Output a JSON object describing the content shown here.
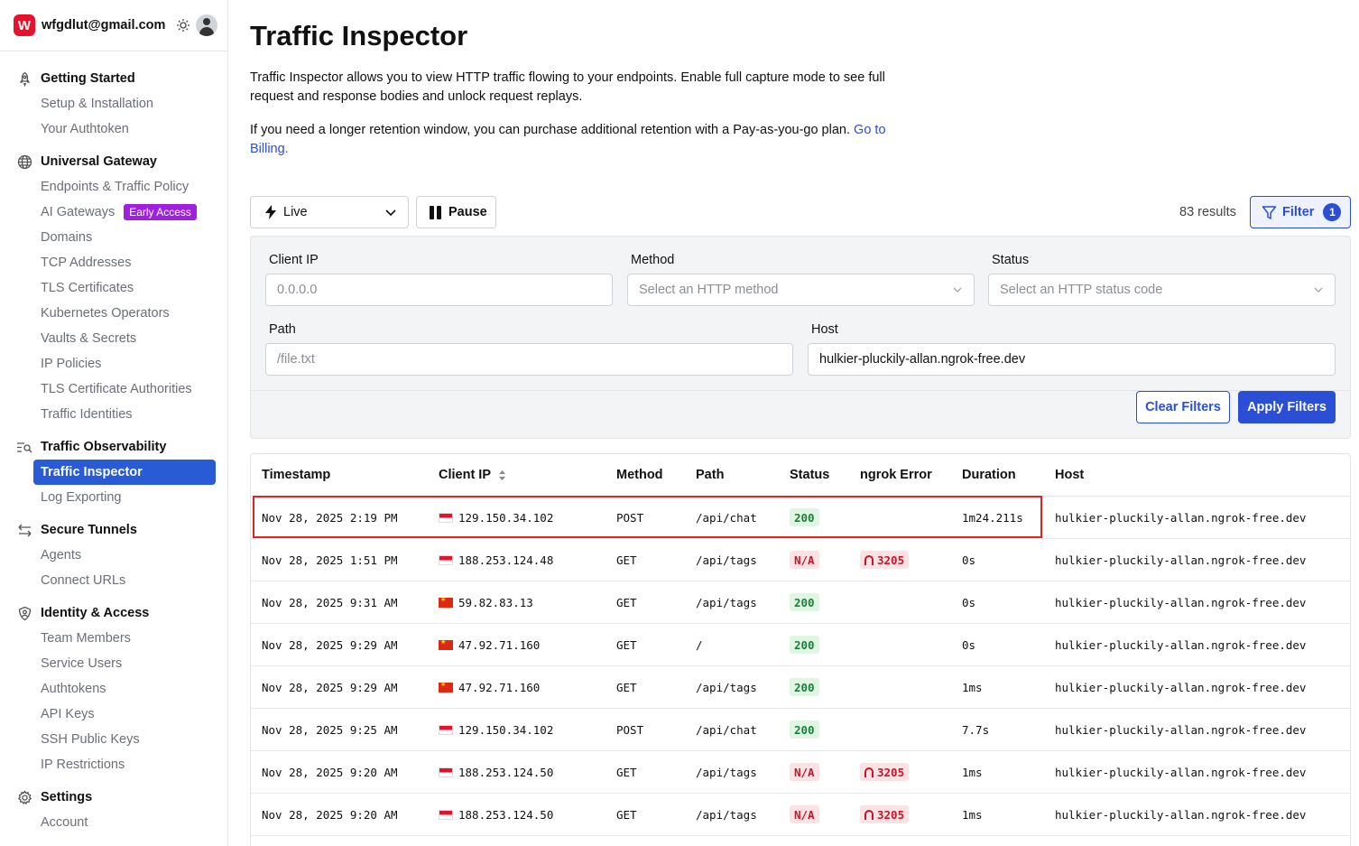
{
  "account": {
    "logo_letter": "W",
    "email": "wfgdlut@gmail.com"
  },
  "sidebar": {
    "groups": [
      {
        "title": "Getting Started",
        "icon": "rocket-icon",
        "items": [
          "Setup & Installation",
          "Your Authtoken"
        ]
      },
      {
        "title": "Universal Gateway",
        "icon": "globe-icon",
        "items": [
          "Endpoints & Traffic Policy",
          "AI Gateways",
          "Domains",
          "TCP Addresses",
          "TLS Certificates",
          "Kubernetes Operators",
          "Vaults & Secrets",
          "IP Policies",
          "TLS Certificate Authorities",
          "Traffic Identities"
        ]
      },
      {
        "title": "Traffic Observability",
        "icon": "list-search-icon",
        "items": [
          "Traffic Inspector",
          "Log Exporting"
        ]
      },
      {
        "title": "Secure Tunnels",
        "icon": "arrows-icon",
        "items": [
          "Agents",
          "Connect URLs"
        ]
      },
      {
        "title": "Identity & Access",
        "icon": "shield-icon",
        "items": [
          "Team Members",
          "Service Users",
          "Authtokens",
          "API Keys",
          "SSH Public Keys",
          "IP Restrictions"
        ]
      },
      {
        "title": "Settings",
        "icon": "gear-icon",
        "items": [
          "Account"
        ]
      }
    ],
    "early_access_badge": "Early Access"
  },
  "page": {
    "title": "Traffic Inspector",
    "intro1": "Traffic Inspector allows you to view HTTP traffic flowing to your endpoints. Enable full capture mode to see full request and response bodies and unlock request replays.",
    "intro2": "If you need a longer retention window, you can purchase additional retention with a Pay-as-you-go plan.",
    "billing_link": "Go to Billing."
  },
  "toolbar": {
    "mode": "Live",
    "pause_label": "Pause",
    "results": "83 results",
    "filter_label": "Filter",
    "filter_count": "1"
  },
  "filters": {
    "client_ip_label": "Client IP",
    "client_ip_placeholder": "0.0.0.0",
    "method_label": "Method",
    "method_placeholder": "Select an HTTP method",
    "status_label": "Status",
    "status_placeholder": "Select an HTTP status code",
    "path_label": "Path",
    "path_placeholder": "/file.txt",
    "host_label": "Host",
    "host_value": "hulkier-pluckily-allan.ngrok-free.dev",
    "clear_label": "Clear Filters",
    "apply_label": "Apply Filters"
  },
  "table": {
    "headers": {
      "timestamp": "Timestamp",
      "client_ip": "Client IP",
      "method": "Method",
      "path": "Path",
      "status": "Status",
      "error": "ngrok Error",
      "duration": "Duration",
      "host": "Host"
    },
    "rows": [
      {
        "timestamp": "Nov 28, 2025 2:19 PM",
        "flag": "sg",
        "ip": "129.150.34.102",
        "method": "POST",
        "path": "/api/chat",
        "status": "200",
        "status_kind": "ok",
        "error": "",
        "duration": "1m24.211s",
        "host": "hulkier-pluckily-allan.ngrok-free.dev"
      },
      {
        "timestamp": "Nov 28, 2025 1:51 PM",
        "flag": "sg",
        "ip": "188.253.124.48",
        "method": "GET",
        "path": "/api/tags",
        "status": "N/A",
        "status_kind": "na",
        "error": "3205",
        "duration": "0s",
        "host": "hulkier-pluckily-allan.ngrok-free.dev"
      },
      {
        "timestamp": "Nov 28, 2025 9:31 AM",
        "flag": "cn",
        "ip": "59.82.83.13",
        "method": "GET",
        "path": "/api/tags",
        "status": "200",
        "status_kind": "ok",
        "error": "",
        "duration": "0s",
        "host": "hulkier-pluckily-allan.ngrok-free.dev"
      },
      {
        "timestamp": "Nov 28, 2025 9:29 AM",
        "flag": "cn",
        "ip": "47.92.71.160",
        "method": "GET",
        "path": "/",
        "status": "200",
        "status_kind": "ok",
        "error": "",
        "duration": "0s",
        "host": "hulkier-pluckily-allan.ngrok-free.dev"
      },
      {
        "timestamp": "Nov 28, 2025 9:29 AM",
        "flag": "cn",
        "ip": "47.92.71.160",
        "method": "GET",
        "path": "/api/tags",
        "status": "200",
        "status_kind": "ok",
        "error": "",
        "duration": "1ms",
        "host": "hulkier-pluckily-allan.ngrok-free.dev"
      },
      {
        "timestamp": "Nov 28, 2025 9:25 AM",
        "flag": "sg",
        "ip": "129.150.34.102",
        "method": "POST",
        "path": "/api/chat",
        "status": "200",
        "status_kind": "ok",
        "error": "",
        "duration": "7.7s",
        "host": "hulkier-pluckily-allan.ngrok-free.dev"
      },
      {
        "timestamp": "Nov 28, 2025 9:20 AM",
        "flag": "sg",
        "ip": "188.253.124.50",
        "method": "GET",
        "path": "/api/tags",
        "status": "N/A",
        "status_kind": "na",
        "error": "3205",
        "duration": "1ms",
        "host": "hulkier-pluckily-allan.ngrok-free.dev"
      },
      {
        "timestamp": "Nov 28, 2025 9:20 AM",
        "flag": "sg",
        "ip": "188.253.124.50",
        "method": "GET",
        "path": "/api/tags",
        "status": "N/A",
        "status_kind": "na",
        "error": "3205",
        "duration": "1ms",
        "host": "hulkier-pluckily-allan.ngrok-free.dev"
      }
    ]
  }
}
